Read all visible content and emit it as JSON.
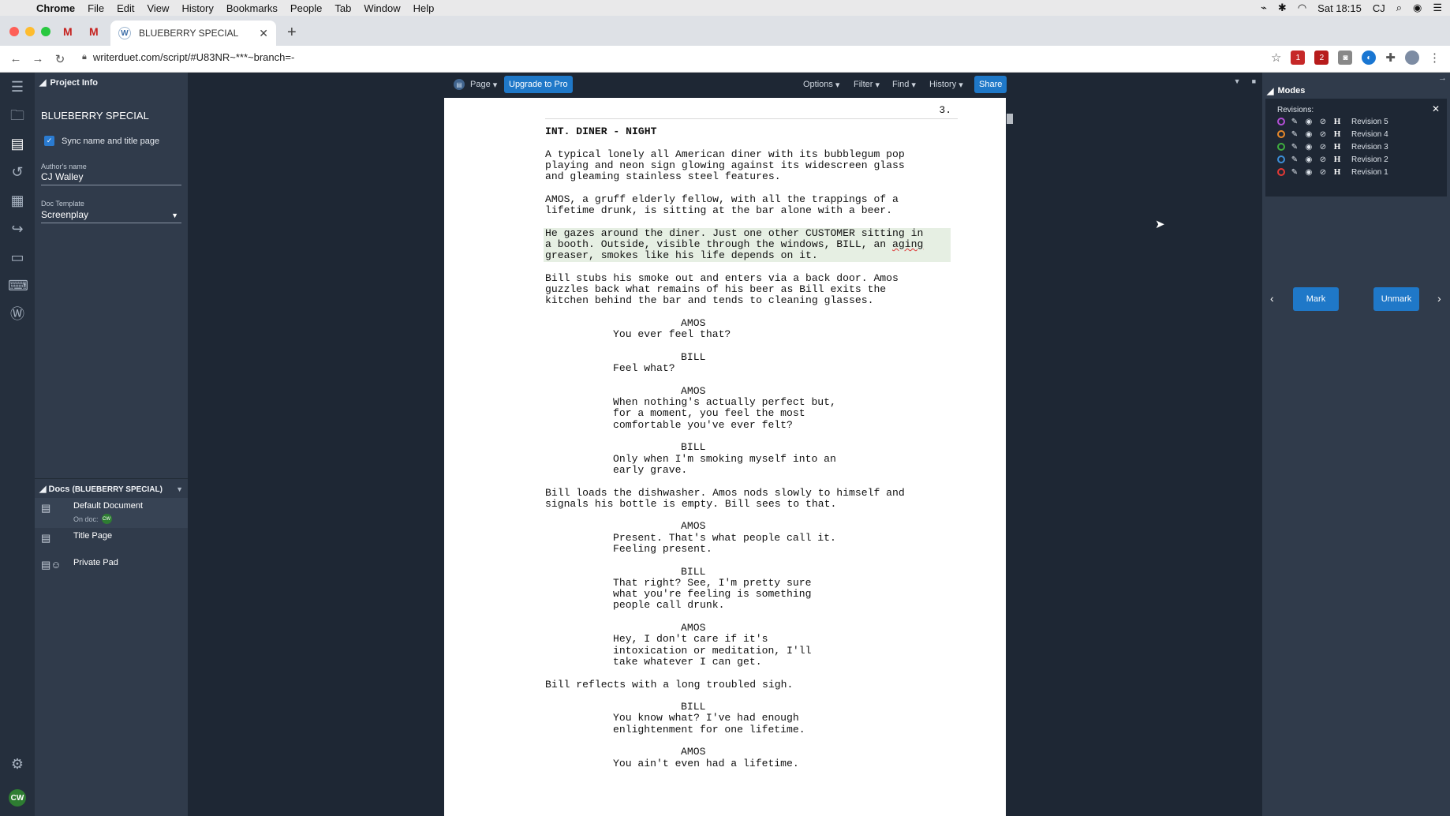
{
  "menubar": {
    "app": "Chrome",
    "items": [
      "File",
      "Edit",
      "View",
      "History",
      "Bookmarks",
      "People",
      "Tab",
      "Window",
      "Help"
    ],
    "clock": "Sat 18:15",
    "user": "CJ"
  },
  "browser": {
    "tab_title": "BLUEBERRY SPECIAL",
    "url": "writerduet.com/script/#U83NR~***~branch=-",
    "ext_badges": [
      "1",
      "2"
    ]
  },
  "project": {
    "header": "Project Info",
    "title": "BLUEBERRY SPECIAL",
    "sync_label": "Sync name and title page",
    "author_label": "Author's name",
    "author_value": "CJ Walley",
    "template_label": "Doc Template",
    "template_value": "Screenplay"
  },
  "docs": {
    "header": "Docs",
    "header_sub": "(BLUEBERRY SPECIAL)",
    "items": [
      {
        "label": "Default Document",
        "sub": "On doc:",
        "badge": "CW"
      },
      {
        "label": "Title Page"
      },
      {
        "label": "Private Pad"
      }
    ]
  },
  "toolbar": {
    "page": "Page",
    "upgrade": "Upgrade to Pro",
    "options": "Options",
    "filter": "Filter",
    "find": "Find",
    "history": "History",
    "share": "Share"
  },
  "script": {
    "page_number": "3.",
    "scene": "INT. DINER - NIGHT",
    "action1": "A typical lonely all American diner with its bubblegum pop\nplaying and neon sign glowing against its widescreen glass\nand gleaming stainless steel features.",
    "action2": "AMOS, a gruff elderly fellow, with all the trappings of a\nlifetime drunk, is sitting at the bar alone with a beer.",
    "action3a": "He gazes around the diner. Just one other CUSTOMER sitting in\na booth. Outside, visible through the windows, BILL, an ",
    "action3_typo": "aging",
    "action3b": "\ngreaser, smokes like his life depends on it.",
    "action4": "Bill stubs his smoke out and enters via a back door. Amos\nguzzles back what remains of his beer as Bill exits the\nkitchen behind the bar and tends to cleaning glasses.",
    "c1": "AMOS",
    "d1": "You ever feel that?",
    "c2": "BILL",
    "d2": "Feel what?",
    "c3": "AMOS",
    "d3": "When nothing's actually perfect but,\nfor a moment, you feel the most\ncomfortable you've ever felt?",
    "c4": "BILL",
    "d4": "Only when I'm smoking myself into an\nearly grave.",
    "action5": "Bill loads the dishwasher. Amos nods slowly to himself and\nsignals his bottle is empty. Bill sees to that.",
    "c5": "AMOS",
    "d5": "Present. That's what people call it.\nFeeling present.",
    "c6": "BILL",
    "d6": "That right? See, I'm pretty sure\nwhat you're feeling is something\npeople call drunk.",
    "c7": "AMOS",
    "d7": "Hey, I don't care if it's\nintoxication or meditation, I'll\ntake whatever I can get.",
    "action6": "Bill reflects with a long troubled sigh.",
    "c8": "BILL",
    "d8": "You know what? I've had enough\nenlightenment for one lifetime.",
    "c9": "AMOS",
    "d9": "You ain't even had a lifetime."
  },
  "modes": {
    "header": "Modes",
    "revisions_label": "Revisions:",
    "revisions": [
      {
        "label": "Revision 5",
        "color": "#b24fd6"
      },
      {
        "label": "Revision 4",
        "color": "#e8892a"
      },
      {
        "label": "Revision 3",
        "color": "#3fae3f"
      },
      {
        "label": "Revision 2",
        "color": "#3d8fd8"
      },
      {
        "label": "Revision 1",
        "color": "#e53935"
      }
    ],
    "mark": "Mark",
    "unmark": "Unmark"
  }
}
